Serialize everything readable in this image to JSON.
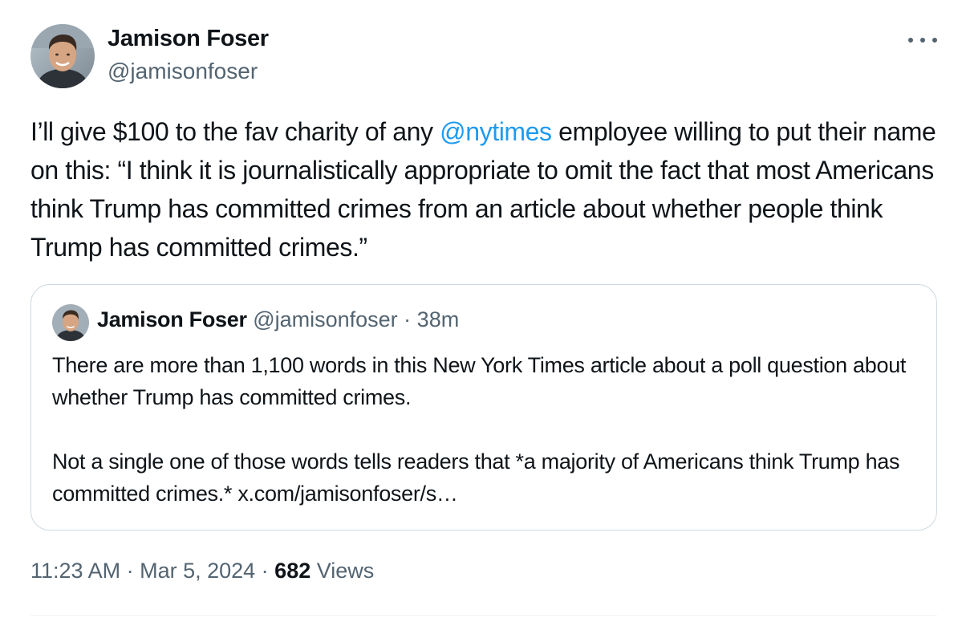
{
  "author": {
    "name": "Jamison Foser",
    "handle": "@jamisonfoser"
  },
  "tweet": {
    "text_before": "I’ll give $100 to the fav charity of any ",
    "mention": "@nytimes",
    "text_after": " employee willing to put their name on this: “I think it is journalistically appropriate to omit the fact that most Americans think Trump has committed crimes from an article about whether people think Trump has committed crimes.”"
  },
  "quoted": {
    "name": "Jamison Foser",
    "handle": "@jamisonfoser",
    "separator": " · ",
    "time": "38m",
    "paragraph1": "There are more than 1,100 words in this New York Times article about a poll question about whether Trump has committed crimes.",
    "paragraph2": "Not a single one of those words tells readers that *a majority of Americans think Trump has committed crimes.* x.com/jamisonfoser/s…"
  },
  "meta": {
    "time": "11:23 AM",
    "date": "Mar 5, 2024",
    "views_count": "682",
    "views_label": "Views",
    "separator": " · "
  },
  "icons": {
    "more": "more-horizontal-icon"
  },
  "colors": {
    "link": "#1d9bf0",
    "secondary_text": "#536471",
    "primary_text": "#0f1419",
    "border": "#cfd9de"
  }
}
